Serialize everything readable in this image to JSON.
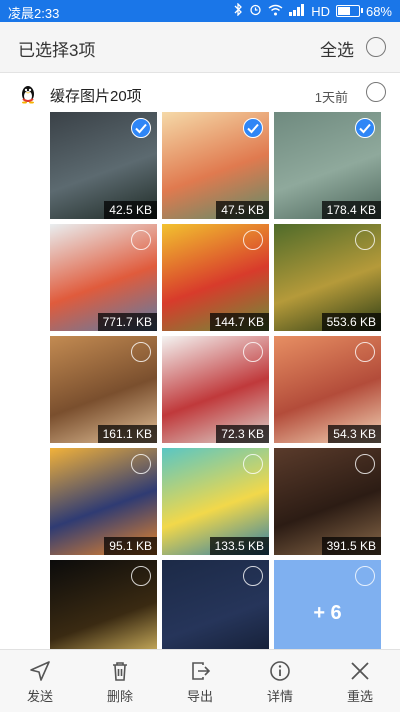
{
  "status": {
    "time": "凌晨2:33",
    "network": "HD",
    "battery": "68%",
    "battery_level": 0.68
  },
  "header": {
    "title": "已选择3项",
    "select_all": "全选"
  },
  "group": {
    "label": "缓存图片20项",
    "time": "1天前"
  },
  "tiles": [
    {
      "size": "42.5 KB",
      "selected": true,
      "colors": [
        "#3a4147",
        "#5c6a70",
        "#1f2b26"
      ]
    },
    {
      "size": "47.5 KB",
      "selected": true,
      "colors": [
        "#f5d9a8",
        "#e07a4f",
        "#5e8c6a"
      ]
    },
    {
      "size": "178.4 KB",
      "selected": true,
      "colors": [
        "#6f8a7f",
        "#8fa99c",
        "#4d665b"
      ]
    },
    {
      "size": "771.7 KB",
      "selected": false,
      "colors": [
        "#e9eef0",
        "#e05b3c",
        "#5a7da8"
      ]
    },
    {
      "size": "144.7 KB",
      "selected": false,
      "colors": [
        "#f2c230",
        "#d83b2b",
        "#6c8f3a"
      ]
    },
    {
      "size": "553.6 KB",
      "selected": false,
      "colors": [
        "#4f6b2a",
        "#b59a3a",
        "#2c3d15"
      ]
    },
    {
      "size": "161.1 KB",
      "selected": false,
      "colors": [
        "#c38b52",
        "#7a4f2e",
        "#e3c29a"
      ]
    },
    {
      "size": "72.3 KB",
      "selected": false,
      "colors": [
        "#f4f4f2",
        "#c0393b",
        "#dcd6cf"
      ]
    },
    {
      "size": "54.3 KB",
      "selected": false,
      "colors": [
        "#e78f63",
        "#b34c3a",
        "#f3d5b8"
      ]
    },
    {
      "size": "95.1 KB",
      "selected": false,
      "colors": [
        "#f2b23a",
        "#2f3b73",
        "#e9862a"
      ]
    },
    {
      "size": "133.5 KB",
      "selected": false,
      "colors": [
        "#59c6c4",
        "#f2d84a",
        "#2e7ea8"
      ]
    },
    {
      "size": "391.5 KB",
      "selected": false,
      "colors": [
        "#5a3b2b",
        "#2c1c14",
        "#8a6a4a"
      ]
    },
    {
      "size": "",
      "selected": false,
      "colors": [
        "#0b0b0b",
        "#3a2a12",
        "#f0d070"
      ]
    },
    {
      "size": "",
      "selected": false,
      "colors": [
        "#1c2a47",
        "#26355a",
        "#111a2e"
      ]
    },
    {
      "size": "",
      "selected": false,
      "more": "+ 6",
      "colors": [
        "#7fb0f0",
        "#7fb0f0",
        "#7fb0f0"
      ]
    }
  ],
  "toolbar": [
    {
      "label": "发送",
      "icon": "send-icon"
    },
    {
      "label": "删除",
      "icon": "trash-icon"
    },
    {
      "label": "导出",
      "icon": "export-icon"
    },
    {
      "label": "详情",
      "icon": "info-icon"
    },
    {
      "label": "重选",
      "icon": "close-icon"
    }
  ],
  "colors": {
    "status_bar": "#1a76e8",
    "check": "#2f86f6"
  }
}
